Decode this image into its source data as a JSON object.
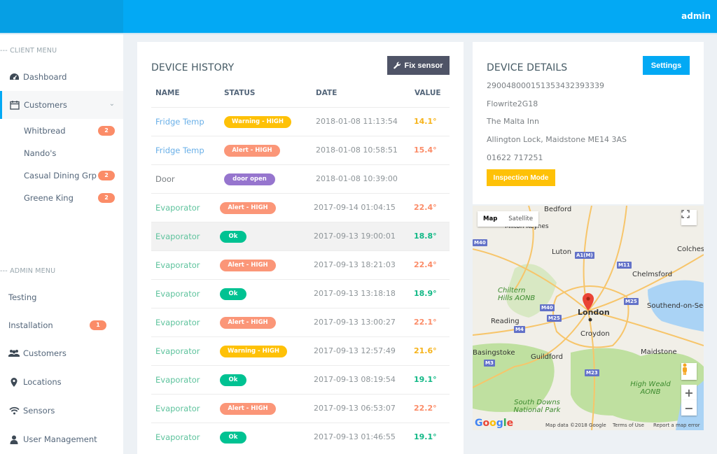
{
  "topbar": {
    "user": "admin"
  },
  "sidebar": {
    "client_menu_label": "--- CLIENT MENU",
    "admin_menu_label": "--- ADMIN MENU",
    "client_items": [
      {
        "label": "Dashboard",
        "icon": "dashboard-icon"
      },
      {
        "label": "Customers",
        "icon": "calendar-icon",
        "active": true
      }
    ],
    "customer_subitems": [
      {
        "label": "Whitbread",
        "badge": "2"
      },
      {
        "label": "Nando's",
        "badge": null
      },
      {
        "label": "Casual Dining Grp",
        "badge": "2"
      },
      {
        "label": "Greene King",
        "badge": "2"
      }
    ],
    "admin_items": [
      {
        "label": "Testing"
      },
      {
        "label": "Installation",
        "badge": "1"
      },
      {
        "label": "Customers",
        "icon": "users-icon"
      },
      {
        "label": "Locations",
        "icon": "map-marker-icon"
      },
      {
        "label": "Sensors",
        "icon": "wifi-icon"
      },
      {
        "label": "User Management",
        "icon": "user-icon"
      }
    ]
  },
  "history": {
    "title": "DEVICE HISTORY",
    "fix_button": "Fix sensor",
    "columns": [
      "NAME",
      "STATUS",
      "DATE",
      "VALUE"
    ],
    "rows": [
      {
        "name": "Fridge Temp",
        "status": "Warning - HIGH",
        "kind": "warning",
        "date": "2018-01-08 11:13:54",
        "value": "14.1°"
      },
      {
        "name": "Fridge Temp",
        "status": "Alert - HIGH",
        "kind": "alert",
        "date": "2018-01-08 10:58:51",
        "value": "15.4°"
      },
      {
        "name": "Door",
        "status": "door open",
        "kind": "door",
        "date": "2018-01-08 10:39:00",
        "value": ""
      },
      {
        "name": "Evaporator",
        "status": "Alert - HIGH",
        "kind": "alert",
        "date": "2017-09-14 01:04:15",
        "value": "22.4°"
      },
      {
        "name": "Evaporator",
        "status": "Ok",
        "kind": "ok",
        "date": "2017-09-13 19:00:01",
        "value": "18.8°"
      },
      {
        "name": "Evaporator",
        "status": "Alert - HIGH",
        "kind": "alert",
        "date": "2017-09-13 18:21:03",
        "value": "22.4°"
      },
      {
        "name": "Evaporator",
        "status": "Ok",
        "kind": "ok",
        "date": "2017-09-13 13:18:18",
        "value": "18.9°"
      },
      {
        "name": "Evaporator",
        "status": "Alert - HIGH",
        "kind": "alert",
        "date": "2017-09-13 13:00:27",
        "value": "22.1°"
      },
      {
        "name": "Evaporator",
        "status": "Warning - HIGH",
        "kind": "warning",
        "date": "2017-09-13 12:57:49",
        "value": "21.6°"
      },
      {
        "name": "Evaporator",
        "status": "Ok",
        "kind": "ok",
        "date": "2017-09-13 08:19:54",
        "value": "19.1°"
      },
      {
        "name": "Evaporator",
        "status": "Alert - HIGH",
        "kind": "alert",
        "date": "2017-09-13 06:53:07",
        "value": "22.2°"
      },
      {
        "name": "Evaporator",
        "status": "Ok",
        "kind": "ok",
        "date": "2017-09-13 01:46:55",
        "value": "19.1°"
      }
    ]
  },
  "colors": {
    "primary": "#03a9f4",
    "warning": "#fec107",
    "alert": "#fb9678",
    "ok": "#00c292",
    "door": "#9675ce",
    "name_fridge": "#6ab0e8",
    "name_door": "#7a7f83",
    "name_evap": "#5ec39d",
    "value_warning": "#f6b31a",
    "value_alert": "#fb8c68",
    "value_ok": "#12b886"
  },
  "details": {
    "title": "DEVICE DETAILS",
    "settings_button": "Settings",
    "lines": [
      "290048000151353432393339",
      "Flowrite2G18",
      "The Malta Inn",
      "Allington Lock, Maidstone ME14 3AS",
      "01622 717251"
    ],
    "inspection_button": "Inspection Mode"
  },
  "map": {
    "type_map": "Map",
    "type_satellite": "Satellite",
    "places": [
      "Bedford",
      "Milton Keynes",
      "Luton",
      "Colchester",
      "Chelmsford",
      "Chiltern Hills AONB",
      "London",
      "Southend-on-Sea",
      "Reading",
      "Croydon",
      "Basingstoke",
      "Guildford",
      "Maidstone",
      "High Weald AONB",
      "South Downs National Park"
    ],
    "roads": [
      "M40",
      "A1(M)",
      "M11",
      "M25",
      "M4",
      "M3",
      "M23"
    ],
    "attribution": "Map data ©2018 Google",
    "terms": "Terms of Use",
    "report": "Report a map error",
    "logo": "Google"
  }
}
